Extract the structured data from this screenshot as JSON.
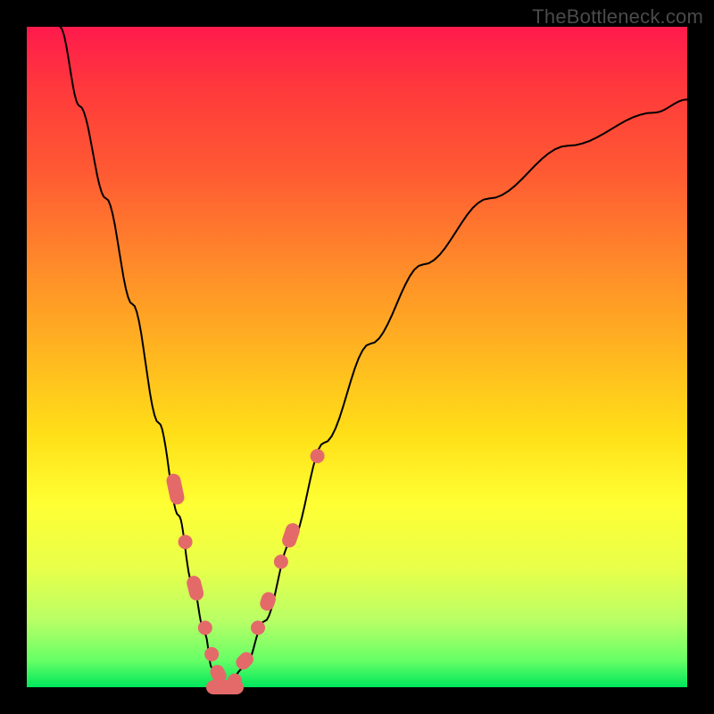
{
  "watermark": "TheBottleneck.com",
  "chart_data": {
    "type": "line",
    "title": "",
    "xlabel": "",
    "ylabel": "",
    "xlim": [
      0,
      100
    ],
    "ylim": [
      0,
      100
    ],
    "grid": false,
    "legend": false,
    "curve": {
      "name": "bottleneck-curve",
      "x": [
        5,
        8,
        12,
        16,
        20,
        23,
        25,
        27,
        28,
        29,
        30,
        33,
        36,
        40,
        45,
        52,
        60,
        70,
        82,
        95,
        100
      ],
      "y": [
        100,
        88,
        74,
        58,
        40,
        26,
        16,
        8,
        3,
        1,
        0,
        3,
        10,
        22,
        37,
        52,
        64,
        74,
        82,
        87,
        89
      ]
    },
    "markers": {
      "name": "highlight-points",
      "color": "#e46a6a",
      "points": [
        {
          "x": 22.5,
          "y": 30,
          "shape": "pill",
          "len": 5
        },
        {
          "x": 24.0,
          "y": 22,
          "shape": "dot"
        },
        {
          "x": 25.5,
          "y": 15,
          "shape": "pill",
          "len": 4
        },
        {
          "x": 27.0,
          "y": 9,
          "shape": "dot"
        },
        {
          "x": 28.0,
          "y": 5,
          "shape": "dot"
        },
        {
          "x": 29.0,
          "y": 2,
          "shape": "pill",
          "len": 3
        },
        {
          "x": 30.0,
          "y": 0,
          "shape": "pill",
          "len": 6,
          "horiz": true
        },
        {
          "x": 31.5,
          "y": 1,
          "shape": "dot"
        },
        {
          "x": 33.0,
          "y": 4,
          "shape": "pill",
          "len": 3
        },
        {
          "x": 35.0,
          "y": 9,
          "shape": "dot"
        },
        {
          "x": 36.5,
          "y": 13,
          "shape": "pill",
          "len": 3
        },
        {
          "x": 38.5,
          "y": 19,
          "shape": "dot"
        },
        {
          "x": 40.0,
          "y": 23,
          "shape": "pill",
          "len": 4
        },
        {
          "x": 44.0,
          "y": 35,
          "shape": "dot"
        }
      ]
    }
  }
}
